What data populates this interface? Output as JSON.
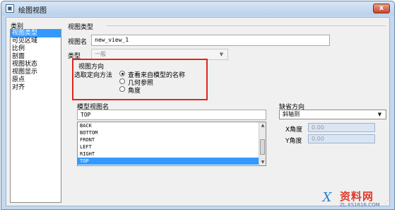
{
  "window": {
    "title": "绘图视图",
    "app_icon": "drawing-view-icon",
    "close_label": "x"
  },
  "sidebar": {
    "heading": "类别",
    "items": [
      {
        "label": "视图类型",
        "selected": true
      },
      {
        "label": "可见区域",
        "selected": false
      },
      {
        "label": "比例",
        "selected": false
      },
      {
        "label": "剖面",
        "selected": false
      },
      {
        "label": "视图状态",
        "selected": false
      },
      {
        "label": "视图显示",
        "selected": false
      },
      {
        "label": "原点",
        "selected": false
      },
      {
        "label": "对齐",
        "selected": false
      }
    ]
  },
  "view_type": {
    "section_title": "视图类型",
    "name_label": "视图名",
    "name_value": "new_view_1",
    "type_label": "类型",
    "type_value": "一般"
  },
  "orientation": {
    "group_title": "视图方向",
    "method_label": "选取定向方法",
    "options": [
      {
        "label": "查看来自模型的名称",
        "checked": true
      },
      {
        "label": "几何参照",
        "checked": false
      },
      {
        "label": "角度",
        "checked": false
      }
    ]
  },
  "model_views": {
    "label": "模型视图名",
    "search_value": "TOP",
    "items": [
      {
        "label": "BACK",
        "selected": false
      },
      {
        "label": "BOTTOM",
        "selected": false
      },
      {
        "label": "FRONT",
        "selected": false
      },
      {
        "label": "LEFT",
        "selected": false
      },
      {
        "label": "RIGHT",
        "selected": false
      },
      {
        "label": "TOP",
        "selected": true
      }
    ]
  },
  "default_orientation": {
    "label": "缺省方向",
    "value": "斜轴测",
    "x_angle_label": "X角度",
    "x_angle_value": "0.00",
    "y_angle_label": "Y角度",
    "y_angle_value": "0.00"
  },
  "watermark": {
    "title": "资料网",
    "url": "ZL.XS1616.COM",
    "logo_glyph": "X"
  },
  "colors": {
    "selection": "#3399ff",
    "highlight_box": "#e0261b",
    "frame": "#c4d8ef"
  }
}
